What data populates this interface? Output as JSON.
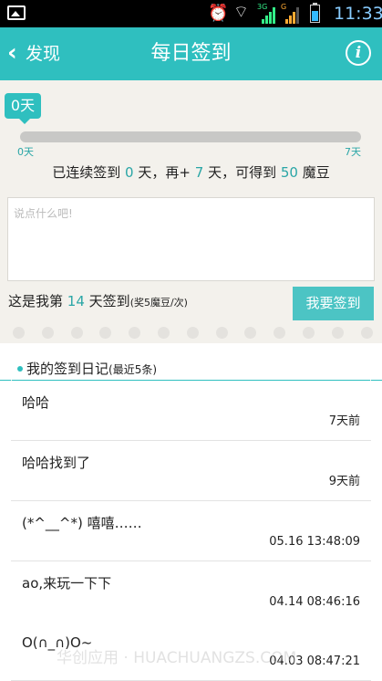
{
  "status_bar": {
    "time": "11:33",
    "network_3g": "3G",
    "network_g": "G"
  },
  "header": {
    "back_label": "发现",
    "title": "每日签到"
  },
  "progress": {
    "bubble_label": "0天",
    "start_label": "0天",
    "end_label": "7天",
    "current_days": 0,
    "total_days": 7
  },
  "summary": {
    "prefix": "已连续签到",
    "streak": "0",
    "mid1": "天，再+",
    "remaining": "7",
    "mid2": "天，可得到",
    "reward": "50",
    "suffix": "魔豆"
  },
  "note": {
    "placeholder": "说点什么吧!",
    "value": ""
  },
  "checkin": {
    "prefix": "这是我第",
    "day_number": "14",
    "suffix": "天签到",
    "reward_note": "(奖5魔豆/次)",
    "button_label": "我要签到"
  },
  "diary": {
    "title": "我的签到日记",
    "subtitle": "(最近5条)",
    "entries": [
      {
        "content": "哈哈",
        "time": "7天前"
      },
      {
        "content": "哈哈找到了",
        "time": "9天前"
      },
      {
        "content": "(*^__^*) 嘻嘻……",
        "time": "05.16 13:48:09"
      },
      {
        "content": "ao,来玩一下下",
        "time": "04.14 08:46:16"
      },
      {
        "content": "O(∩_∩)O~",
        "time": "04.03 08:47:21"
      }
    ]
  },
  "watermark": "华创应用 · HUACHUANGZS.COM",
  "colors": {
    "accent": "#2fbfbf",
    "button": "#4cc4c4",
    "panel": "#f3f1ec"
  }
}
